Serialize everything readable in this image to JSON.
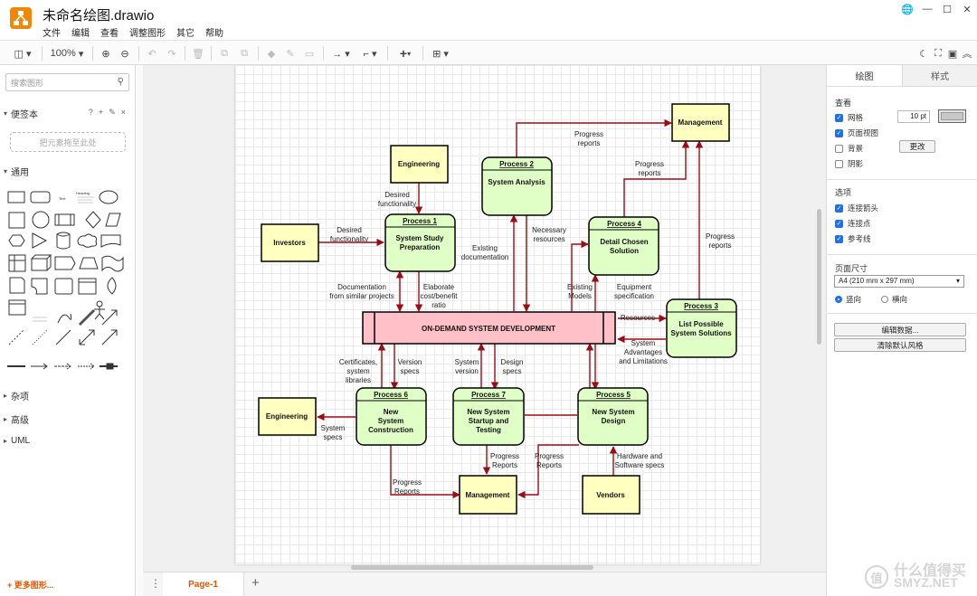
{
  "app": {
    "title": "未命名绘图.drawio"
  },
  "menu": [
    "文件",
    "编辑",
    "查看",
    "调整图形",
    "其它",
    "帮助"
  ],
  "toolbar": {
    "zoom": "100%"
  },
  "sidebar": {
    "search_placeholder": "搜索图形",
    "scratchpad": "便签本",
    "scratchpad_tools": [
      "?",
      "+",
      "✎",
      "×"
    ],
    "dropzone": "把元素拖至此处",
    "general": "通用",
    "misc": "杂项",
    "advanced": "高级",
    "uml": "UML",
    "more_shapes": "+ 更多图形...",
    "shape_labels": {
      "text": "Text",
      "heading": "Heading"
    }
  },
  "page": {
    "tab": "Page-1"
  },
  "format": {
    "tabs": [
      "绘图",
      "样式"
    ],
    "view": "查看",
    "grid": "网格",
    "grid_size": "10 pt",
    "page_view": "页面视图",
    "background": "背景",
    "change": "更改",
    "shadow": "阴影",
    "options": "选项",
    "connection_arrows": "连接箭头",
    "connection_points": "连接点",
    "guides": "参考线",
    "paper_size": "页面尺寸",
    "paper_value": "A4 (210 mm x 297 mm)",
    "portrait": "竖向",
    "landscape": "横向",
    "edit_data": "编辑数据...",
    "clear_style": "清除默认风格"
  },
  "diagram": {
    "nodes": {
      "management_top": "Management",
      "engineering_top": "Engineering",
      "investors": "Investors",
      "engineering_left": "Engineering",
      "management_bottom": "Management",
      "vendors": "Vendors",
      "central": "ON-DEMAND SYSTEM DEVELOPMENT",
      "p1": {
        "header": "Process 1",
        "body": [
          "System Study",
          "Preparation"
        ]
      },
      "p2": {
        "header": "Process 2",
        "body": [
          "System Analysis"
        ]
      },
      "p3": {
        "header": "Process 3",
        "body": [
          "List Possible",
          "System Solutions"
        ]
      },
      "p4": {
        "header": "Process 4",
        "body": [
          "Detail Chosen",
          "Solution"
        ]
      },
      "p5": {
        "header": "Process 5",
        "body": [
          "New System",
          "Design"
        ]
      },
      "p6": {
        "header": "Process 6",
        "body": [
          "New",
          "System",
          "Construction"
        ]
      },
      "p7": {
        "header": "Process 7",
        "body": [
          "New System",
          "Startup and",
          "Testing"
        ]
      }
    },
    "labels": {
      "progress_reports_top": [
        "Progress",
        "reports"
      ],
      "progress_reports_p4": [
        "Progress",
        "reports"
      ],
      "progress_reports_p3": [
        "Progress",
        "reports"
      ],
      "desired_functionality_1": [
        "Desired",
        "functionality"
      ],
      "desired_functionality_2": [
        "Desired",
        "functionality"
      ],
      "existing_documentation": [
        "Existing",
        "documentation"
      ],
      "necessary_resources": [
        "Necessary",
        "resources"
      ],
      "documentation_similar": [
        "Documentation",
        "from similar projects"
      ],
      "elaborate": [
        "Elaborate",
        "cost/benefit",
        "ratio"
      ],
      "existing_models": [
        "Existing",
        "Models"
      ],
      "equipment_spec": [
        "Equipment",
        "specification"
      ],
      "resources": [
        "Resources"
      ],
      "system_advantages": [
        "System",
        "Advantages",
        "and Limitations"
      ],
      "certificates": [
        "Certificates,",
        "system",
        "libraries"
      ],
      "version_specs": [
        "Version",
        "specs"
      ],
      "system_version": [
        "System",
        "version"
      ],
      "design_specs": [
        "Design",
        "specs"
      ],
      "system_specs": [
        "System",
        "specs"
      ],
      "progress_reports_p6": [
        "Progress",
        "Reports"
      ],
      "progress_reports_p7": [
        "Progress",
        "Reports"
      ],
      "progress_reports_p5": [
        "Progress",
        "Reports"
      ],
      "hardware_software": [
        "Hardware and",
        "Software specs"
      ]
    }
  },
  "watermark": {
    "glyph": "值",
    "text": "什么值得买",
    "site": "SMYZ.NET"
  }
}
